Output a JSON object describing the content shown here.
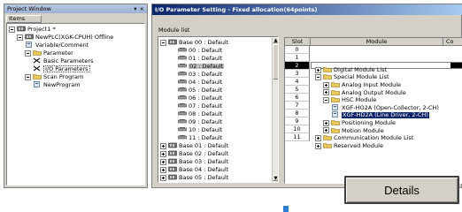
{
  "project_window": {
    "title": "Project Window",
    "tab": "Items",
    "tree": [
      {
        "label": "Project1 *",
        "level": 0,
        "icon": "project-icon"
      },
      {
        "label": "NewPLC(XGK-CPUH) Offline",
        "level": 1,
        "icon": "plc-icon"
      },
      {
        "label": "Variable/Comment",
        "level": 2,
        "icon": "variable-icon"
      },
      {
        "label": "Parameter",
        "level": 2,
        "icon": "parameter-icon"
      },
      {
        "label": "Basic Parameters",
        "level": 3,
        "icon": "basic-param-icon"
      },
      {
        "label": "I/O Parameters",
        "level": 3,
        "icon": "io-param-icon",
        "selected": true
      },
      {
        "label": "Scan Program",
        "level": 2,
        "icon": "scan-program-icon"
      },
      {
        "label": "NewProgram",
        "level": 3,
        "icon": "program-icon"
      }
    ]
  },
  "io_window": {
    "title": "I/O Parameter Setting - Fixed allocation(64points)",
    "module_list_label": "Module list",
    "base_tree": [
      {
        "label": "Base 00 : Default",
        "level": 0,
        "expanded": true
      },
      {
        "label": "00 : Default",
        "level": 1
      },
      {
        "label": "01 : Default",
        "level": 1
      },
      {
        "label": "02 : Default",
        "level": 1,
        "selected": true
      },
      {
        "label": "03 : Default",
        "level": 1
      },
      {
        "label": "04 : Default",
        "level": 1
      },
      {
        "label": "05 : Default",
        "level": 1
      },
      {
        "label": "06 : Default",
        "level": 1
      },
      {
        "label": "07 : Default",
        "level": 1
      },
      {
        "label": "08 : Default",
        "level": 1
      },
      {
        "label": "09 : Default",
        "level": 1
      },
      {
        "label": "10 : Default",
        "level": 1
      },
      {
        "label": "11 : Default",
        "level": 1
      },
      {
        "label": "Base 01 : Default",
        "level": 0
      },
      {
        "label": "Base 02 : Default",
        "level": 0
      },
      {
        "label": "Base 03 : Default",
        "level": 0
      },
      {
        "label": "Base 04 : Default",
        "level": 0
      },
      {
        "label": "Base 05 : Default",
        "level": 0
      }
    ],
    "grid": {
      "headers": [
        "Slot",
        "Module",
        "Co"
      ],
      "slots": [
        "0",
        "1",
        "2",
        "3",
        "4",
        "5",
        "6",
        "7",
        "8",
        "9",
        "10",
        "11"
      ],
      "selected_slot": "2"
    },
    "module_tree": [
      {
        "label": "Digital Module List",
        "level": 0,
        "expanded": false
      },
      {
        "label": "Special Module List",
        "level": 0,
        "expanded": true
      },
      {
        "label": "Analog Input Module",
        "level": 1
      },
      {
        "label": "Analog Output Module",
        "level": 1
      },
      {
        "label": "HSC Module",
        "level": 1,
        "expanded": true
      },
      {
        "label": "XGF-HO2A (Open-Collector, 2-CH)",
        "level": 2
      },
      {
        "label": "XGF-HD2A (Line Driver, 2-CH)",
        "level": 2,
        "selected": true
      },
      {
        "label": "Positioning Module",
        "level": 1
      },
      {
        "label": "Motion Module",
        "level": 1
      },
      {
        "label": "Communication Module List",
        "level": 0
      },
      {
        "label": "Reserved Module",
        "level": 0
      }
    ]
  },
  "details_button": {
    "label": "Details"
  },
  "colors": {
    "selection": "#0a246a",
    "title_bar": "#0a246a",
    "panel": "#d4d0c8"
  }
}
